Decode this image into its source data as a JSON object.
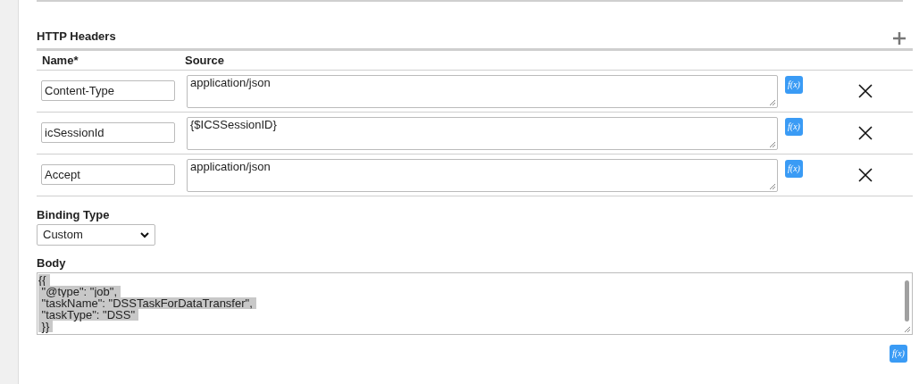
{
  "headers_section": {
    "title": "HTTP Headers",
    "columns": [
      "Name*",
      "Source"
    ],
    "rows": [
      {
        "name": "Content-Type",
        "source": "application/json",
        "function_button": "f(x)"
      },
      {
        "name": "icSessionId",
        "source": "{$ICSSessionID}",
        "function_button": "f(x)"
      },
      {
        "name": "Accept",
        "source": "application/json",
        "function_button": "f(x)"
      }
    ]
  },
  "binding_type": {
    "label": "Binding Type",
    "value": "Custom"
  },
  "body": {
    "label": "Body",
    "text_selected": true,
    "lines": [
      "{{",
      " \"@type\": \"job\",",
      " \"taskName\": \"DSSTaskForDataTransfer\",",
      " \"taskType\": \"DSS\"",
      " }}"
    ],
    "function_button": "f(x)"
  }
}
